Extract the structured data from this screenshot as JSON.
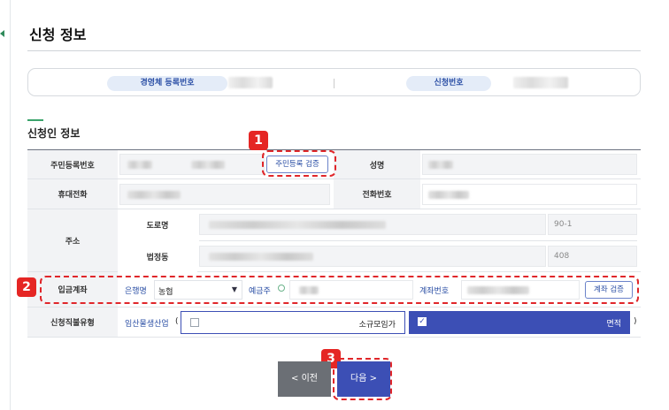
{
  "page": {
    "title": "신청 정보"
  },
  "summary": {
    "biz_reg_label": "경영체 등록번호",
    "application_no_label": "신청번호"
  },
  "section": {
    "title": "신청인 정보"
  },
  "form": {
    "rrn_label": "주민등록번호",
    "rrn_verify_button": "주민등록 검증",
    "name_label": "성명",
    "mobile_label": "휴대전화",
    "phone_label": "전화번호",
    "address_label": "주소",
    "road_label": "도로명",
    "road_building_no": "90-1",
    "legal_label": "법정동",
    "legal_building_no": "408",
    "deposit_label": "입금계좌",
    "bank_label": "은행명",
    "bank_value": "농협",
    "holder_label": "예금주",
    "account_label": "계좌번호",
    "account_verify_button": "계좌 검증",
    "type_label": "신청직불유형",
    "type_link": "임산물생산업",
    "paren_open": "(",
    "paren_close": ")",
    "option_small": "소규모임가",
    "option_area": "면적"
  },
  "nav": {
    "prev": "< 이전",
    "next": "다음 >"
  },
  "callouts": [
    "1",
    "2",
    "3"
  ],
  "colors": {
    "accent_blue": "#3c4fb5",
    "callout_red": "#e52624",
    "section_green": "#3aa36b"
  }
}
